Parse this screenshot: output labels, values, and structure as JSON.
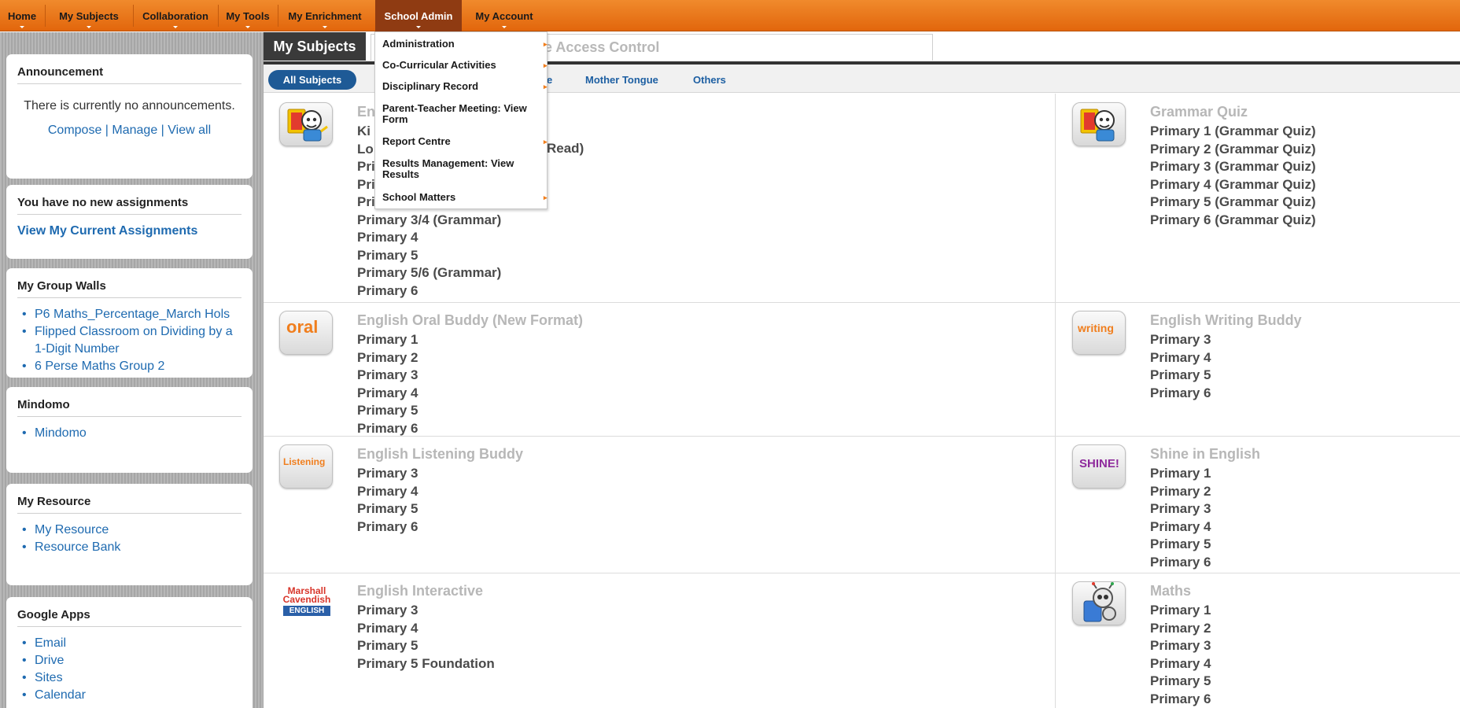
{
  "nav": {
    "items": [
      "Home",
      "My Subjects",
      "Collaboration",
      "My Tools",
      "My Enrichment",
      "School Admin",
      "My Account"
    ]
  },
  "school_admin_menu": {
    "items": [
      "Administration",
      "Co-Curricular Activities",
      "Disciplinary Record",
      "Parent-Teacher Meeting: View Form",
      "Report Centre",
      "Results Management: View Results",
      "School Matters"
    ]
  },
  "sidebar": {
    "announcement": {
      "title": "Announcement",
      "text": "There is currently no announcements.",
      "compose": "Compose",
      "sep1": " | ",
      "manage": "Manage",
      "sep2": " | ",
      "view_all": "View all"
    },
    "assignments": {
      "title": "You have no new assignments",
      "link": "View My Current Assignments"
    },
    "group_walls": {
      "title": "My Group Walls",
      "items": [
        "P6 Maths_Percentage_March Hols",
        "Flipped Classroom on Dividing by a 1-Digit Number",
        "6 Perse Maths Group 2"
      ]
    },
    "mindomo": {
      "title": "Mindomo",
      "items": [
        "Mindomo"
      ]
    },
    "resource": {
      "title": "My Resource",
      "items": [
        "My Resource",
        "Resource Bank"
      ]
    },
    "google": {
      "title": "Google Apps",
      "items": [
        "Email",
        "Drive",
        "Sites",
        "Calendar"
      ]
    }
  },
  "main": {
    "tabs": {
      "active": "My Subjects",
      "second": "e Access Control"
    },
    "filters": {
      "all": "All Subjects",
      "english_partial": "e",
      "mother_tongue": "Mother Tongue",
      "others": "Others"
    },
    "subjects": [
      {
        "title": "En",
        "icon": "grammar-mascot-icon",
        "levels": [
          "Ki",
          "Lo",
          "Pri",
          "Pri",
          "Pri",
          "Primary 3/4 (Grammar)",
          "Primary 4",
          "Primary 5",
          "Primary 5/6 (Grammar)",
          "Primary 6"
        ],
        "partial_read": "Read)"
      },
      {
        "title": "Grammar Quiz",
        "icon": "grammar-quiz-icon",
        "levels": [
          "Primary 1 (Grammar Quiz)",
          "Primary 2 (Grammar Quiz)",
          "Primary 3 (Grammar Quiz)",
          "Primary 4 (Grammar Quiz)",
          "Primary 5 (Grammar Quiz)",
          "Primary 6 (Grammar Quiz)"
        ]
      },
      {
        "title": "English Oral Buddy (New Format)",
        "icon": "oral-buddy-icon",
        "icon_text": "oral",
        "levels": [
          "Primary 1",
          "Primary 2",
          "Primary 3",
          "Primary 4",
          "Primary 5",
          "Primary 6"
        ]
      },
      {
        "title": "English Writing Buddy",
        "icon": "writing-buddy-icon",
        "icon_text": "writing",
        "levels": [
          "Primary 3",
          "Primary 4",
          "Primary 5",
          "Primary 6"
        ]
      },
      {
        "title": "English Listening Buddy",
        "icon": "listening-buddy-icon",
        "icon_text": "Listening",
        "levels": [
          "Primary 3",
          "Primary 4",
          "Primary 5",
          "Primary 6"
        ]
      },
      {
        "title": "Shine in English",
        "icon": "shine-english-icon",
        "icon_text": "SHINE!",
        "levels": [
          "Primary 1",
          "Primary 2",
          "Primary 3",
          "Primary 4",
          "Primary 5",
          "Primary 6"
        ]
      },
      {
        "title": "English Interactive",
        "icon": "marshall-cavendish-icon",
        "icon_text": [
          "Marshall",
          "Cavendish",
          "ENGLISH"
        ],
        "levels": [
          "Primary 3",
          "Primary 4",
          "Primary 5",
          "Primary 5 Foundation"
        ]
      },
      {
        "title": "Maths",
        "icon": "maths-robot-icon",
        "levels": [
          "Primary 1",
          "Primary 2",
          "Primary 3",
          "Primary 4",
          "Primary 5",
          "Primary 6"
        ]
      }
    ]
  },
  "colors": {
    "nav": "#e8731a",
    "link": "#1e6ab0",
    "active_tab": "#3a3a3a",
    "filter_active": "#1e5a96"
  }
}
